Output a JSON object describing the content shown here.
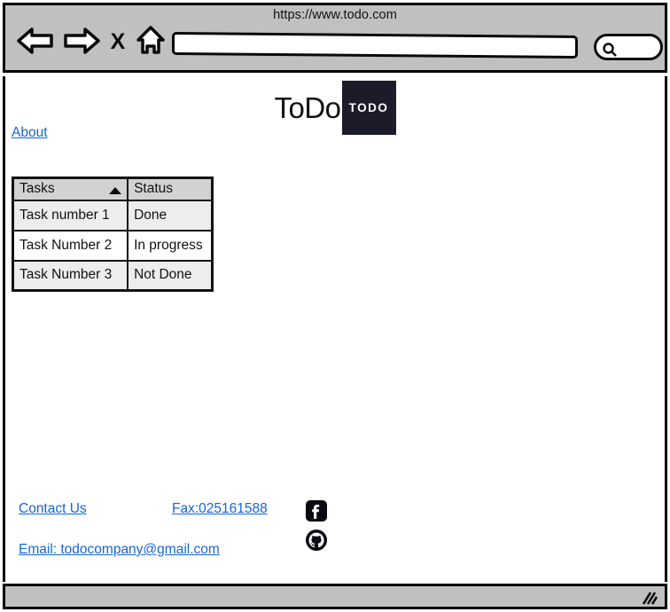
{
  "browser": {
    "url_title": "https://www.todo.com",
    "address_bar_value": "",
    "address_bar_placeholder": "",
    "nav_icons": [
      {
        "name": "back-arrow-icon",
        "label": "Back"
      },
      {
        "name": "forward-arrow-icon",
        "label": "Forward"
      },
      {
        "name": "close-x-icon",
        "label": "Stop"
      },
      {
        "name": "home-icon",
        "label": "Home"
      }
    ],
    "search": {
      "icon": "magnifier-icon",
      "value": "",
      "placeholder": ""
    }
  },
  "header": {
    "brand_title": "ToDo",
    "logo_text": "TODO",
    "logo_color": "#1b1b29",
    "nav": {
      "about_label": "About"
    }
  },
  "table": {
    "columns": [
      {
        "label": "Tasks",
        "sort": "ascending",
        "sort_icon": "sort-ascending-caret-icon"
      },
      {
        "label": "Status",
        "sort": "none"
      }
    ],
    "rows": [
      {
        "task": "Task number 1",
        "status": "Done"
      },
      {
        "task": "Task Number 2",
        "status": "In progress"
      },
      {
        "task": "Task Number 3",
        "status": "Not Done"
      }
    ]
  },
  "footer": {
    "contact_label": "Contact Us",
    "fax_label": "Fax:025161588",
    "email_label": "Email: todocompany@gmail.com",
    "link_color": "#1565d8",
    "social": [
      {
        "name": "facebook-icon",
        "label": "Facebook"
      },
      {
        "name": "github-icon",
        "label": "GitHub"
      }
    ]
  },
  "status_bar": {
    "text": "",
    "grip_icon": "resize-grip-icon"
  }
}
